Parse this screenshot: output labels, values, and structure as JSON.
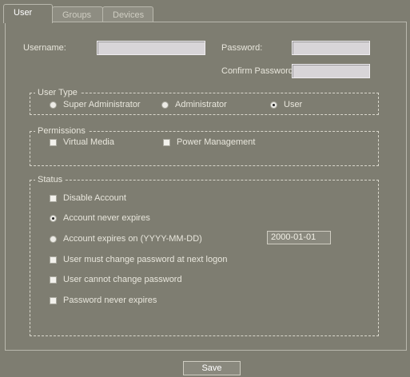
{
  "tabs": [
    {
      "label": "User",
      "active": true
    },
    {
      "label": "Groups",
      "active": false
    },
    {
      "label": "Devices",
      "active": false
    }
  ],
  "credentials": {
    "username_label": "Username:",
    "username_value": "",
    "password_label": "Password:",
    "password_value": "",
    "confirm_label": "Confirm Password:",
    "confirm_value": ""
  },
  "user_type": {
    "legend": "User Type",
    "options": [
      {
        "label": "Super Administrator",
        "selected": false
      },
      {
        "label": "Administrator",
        "selected": false
      },
      {
        "label": "User",
        "selected": true
      }
    ]
  },
  "permissions": {
    "legend": "Permissions",
    "options": [
      {
        "label": "Virtual Media",
        "checked": false
      },
      {
        "label": "Power Management",
        "checked": false
      }
    ]
  },
  "status": {
    "legend": "Status",
    "disable_account": {
      "label": "Disable Account",
      "checked": false
    },
    "never_expires": {
      "label": "Account never expires",
      "selected": true
    },
    "expires_on": {
      "label": "Account expires on (YYYY-MM-DD)",
      "selected": false,
      "date": "2000-01-01"
    },
    "must_change": {
      "label": "User must change password at next logon",
      "checked": false
    },
    "cannot_change": {
      "label": "User cannot change password",
      "checked": false
    },
    "pw_never_expires": {
      "label": "Password never expires",
      "checked": false
    }
  },
  "save_label": "Save",
  "colors": {
    "background": "#7e7d71",
    "field": "#d8d5d8",
    "text": "#e8e6dc"
  }
}
